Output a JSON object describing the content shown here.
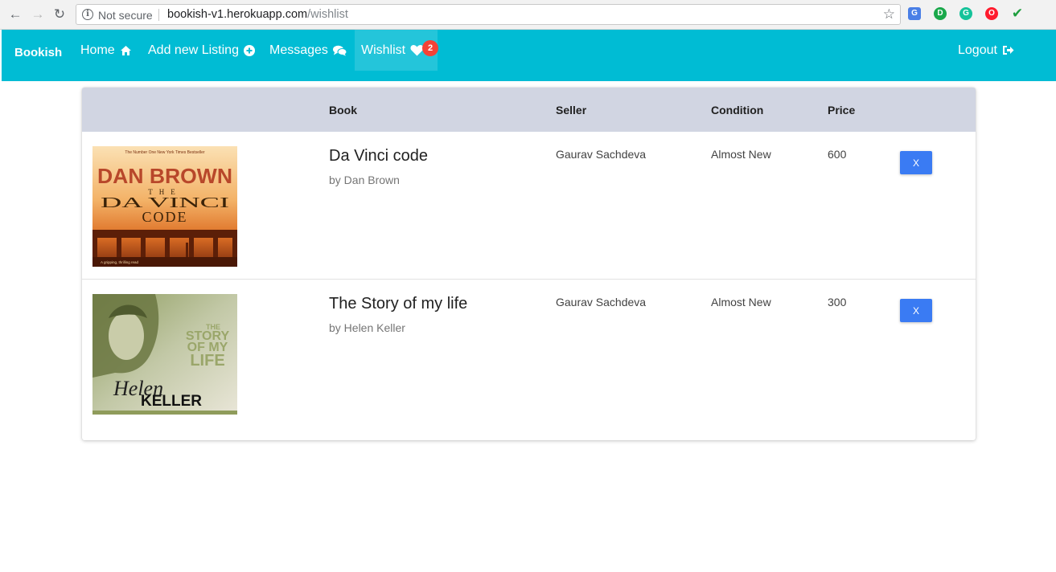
{
  "browser": {
    "security": "Not secure",
    "url_host": "bookish-v1.herokuapp.com",
    "url_path": "/wishlist",
    "extensions": [
      "translate-icon",
      "ld-extension-icon",
      "grammarly-icon",
      "opera-icon",
      "checkmark-icon"
    ]
  },
  "navbar": {
    "brand": "Bookish",
    "home": "Home",
    "add_listing": "Add new Listing",
    "messages": "Messages",
    "wishlist": "Wishlist",
    "wishlist_count": "2",
    "logout": "Logout",
    "color": "#00bcd4"
  },
  "table": {
    "headers": {
      "book": "Book",
      "seller": "Seller",
      "condition": "Condition",
      "price": "Price"
    },
    "rows": [
      {
        "title": "Da Vinci code",
        "author": "by Dan Brown",
        "seller": "Gaurav Sachdeva",
        "condition": "Almost New",
        "price": "600",
        "remove_label": "X",
        "cover": {
          "tagline": "The Number One New York Times Bestseller",
          "author_line": "DAN BROWN",
          "the": "THE",
          "title_line1": "DA VINCI",
          "title_line2": "CODE",
          "footer": "A gripping, thrilling read"
        }
      },
      {
        "title": "The Story of my life",
        "author": "by Helen Keller",
        "seller": "Gaurav Sachdeva",
        "condition": "Almost New",
        "price": "300",
        "remove_label": "X",
        "cover": {
          "title_line1": "THE",
          "title_line2": "STORY",
          "title_line3": "OF MY",
          "title_line4": "LIFE",
          "first_name": "Helen",
          "last_name": "KELLER"
        }
      }
    ]
  }
}
